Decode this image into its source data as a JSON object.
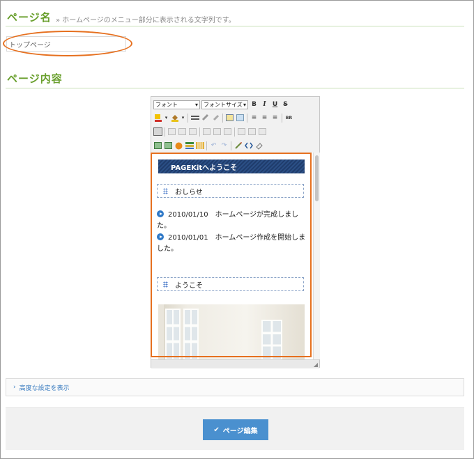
{
  "page_name_section": {
    "title": "ページ名",
    "hint": "» ホームページのメニュー部分に表示される文字列です。",
    "input_value": "トップページ"
  },
  "page_content_section": {
    "title": "ページ内容"
  },
  "editor": {
    "font_select": "フォント",
    "size_select": "フォントサイズ",
    "bold": "B",
    "italic": "I",
    "underline": "U",
    "strike": "S",
    "br_label": "BR",
    "banner_text": "PAGEKitへようこそ",
    "news_box_title": "おしらせ",
    "news_items": [
      "2010/01/10　ホームページが完成しました。",
      "2010/01/01　ホームページ作成を開始しました。"
    ],
    "welcome_box_title": "ようこそ"
  },
  "advanced_settings": {
    "label": "高度な設定を表示"
  },
  "submit": {
    "label": "ページ編集"
  },
  "colors": {
    "section_title": "#6aa02e",
    "highlight": "#e6701f",
    "primary_button": "#4a90cf",
    "banner": "#1f3c6c"
  }
}
